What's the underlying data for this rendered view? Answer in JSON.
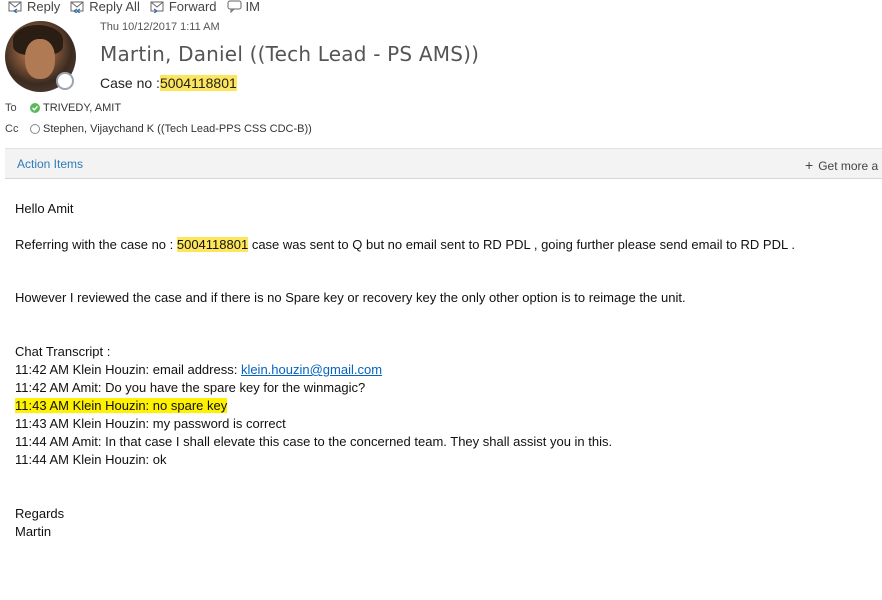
{
  "toolbar": {
    "reply": "Reply",
    "reply_all": "Reply All",
    "forward": "Forward",
    "im": "IM"
  },
  "header": {
    "date": "Thu 10/12/2017 1:11 AM",
    "sender": "Martin, Daniel ((Tech Lead - PS AMS))",
    "subject_prefix": "Case no  :",
    "subject_case": "5004118801"
  },
  "recipients": {
    "to_label": "To",
    "to_name": "TRIVEDY, AMIT",
    "cc_label": "Cc",
    "cc_name": "Stephen, Vijaychand K ((Tech Lead-PPS CSS CDC-B))"
  },
  "actionbar": {
    "action_items": "Action Items",
    "get_more": "Get more a"
  },
  "body": {
    "greeting": "Hello Amit",
    "line1_pre": "Referring with the case no  : ",
    "line1_case": "5004118801",
    "line1_post": " case was sent to Q but no email sent to RD PDL , going further please send email to RD PDL .",
    "line2": "However I reviewed the case and if there is no Spare key or recovery key  the only other option is to reimage the unit.",
    "chat_heading": "Chat Transcript  :",
    "chat1_pre": "11:42 AM Klein Houzin: email address: ",
    "chat1_link": "klein.houzin@gmail.com",
    "chat2": "11:42 AM Amit: Do you have the spare key for the winmagic?",
    "chat3": "11:43 AM Klein Houzin: no spare key",
    "chat4": "11:43 AM Klein Houzin: my password is correct",
    "chat5": "11:44 AM Amit: In that case I shall elevate this case to the concerned team. They shall assist you in this.",
    "chat6": "11:44 AM Klein Houzin: ok",
    "regards": "Regards",
    "signature": "Martin"
  },
  "colors": {
    "highlight": "#fff200",
    "link": "#0563c1",
    "action_link": "#2b7bb9",
    "presence_ok": "#5cb85c"
  }
}
